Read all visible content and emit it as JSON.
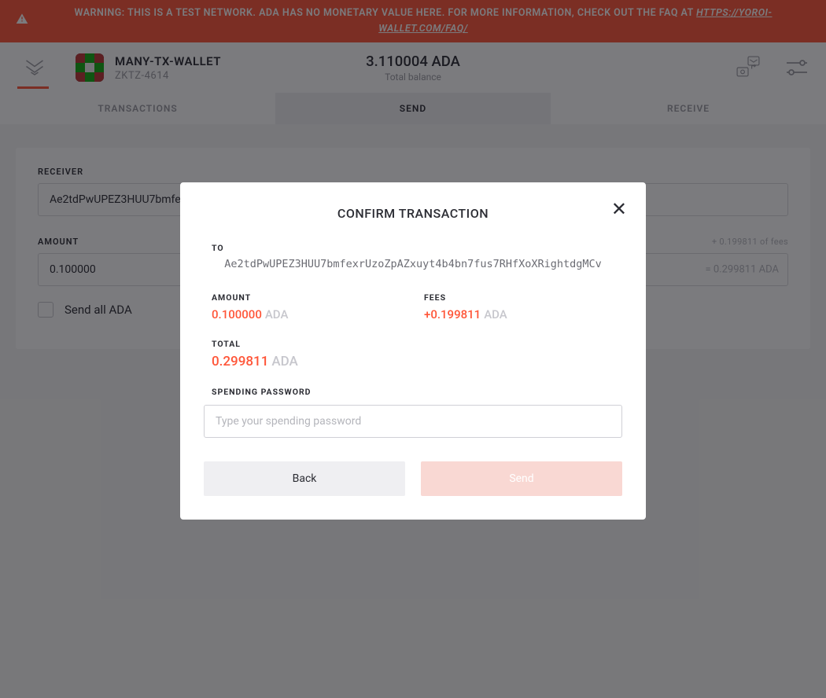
{
  "warning": {
    "text": "WARNING: THIS IS A TEST NETWORK. ADA HAS NO MONETARY VALUE HERE. FOR MORE INFORMATION, CHECK OUT THE FAQ AT ",
    "link_text": "HTTPS://YOROI-WALLET.COM/FAQ/"
  },
  "header": {
    "wallet_name": "MANY-TX-WALLET",
    "wallet_plate": "ZKTZ-4614",
    "balance_value": "3.110004 ADA",
    "balance_label": "Total balance"
  },
  "tabs": {
    "transactions": "TRANSACTIONS",
    "send": "SEND",
    "receive": "RECEIVE"
  },
  "send_form": {
    "receiver_label": "RECEIVER",
    "receiver_value": "Ae2tdPwUPEZ3HUU7bmfe",
    "amount_label": "AMOUNT",
    "amount_hint": "+ 0.199811 of fees",
    "amount_value": "0.100000",
    "amount_equals": "= 0.299811 ADA",
    "send_all_label": "Send all ADA"
  },
  "modal": {
    "title": "CONFIRM TRANSACTION",
    "to_label": "TO",
    "to_address": "Ae2tdPwUPEZ3HUU7bmfexrUzoZpAZxuyt4b4bn7fus7RHfXoXRightdgMCv",
    "amount_label": "AMOUNT",
    "amount_value": "0.100000",
    "amount_unit": "ADA",
    "fees_label": "FEES",
    "fees_value": "+0.199811",
    "fees_unit": "ADA",
    "total_label": "TOTAL",
    "total_value": "0.299811",
    "total_unit": "ADA",
    "password_label": "SPENDING PASSWORD",
    "password_placeholder": "Type your spending password",
    "back_label": "Back",
    "send_label": "Send"
  }
}
